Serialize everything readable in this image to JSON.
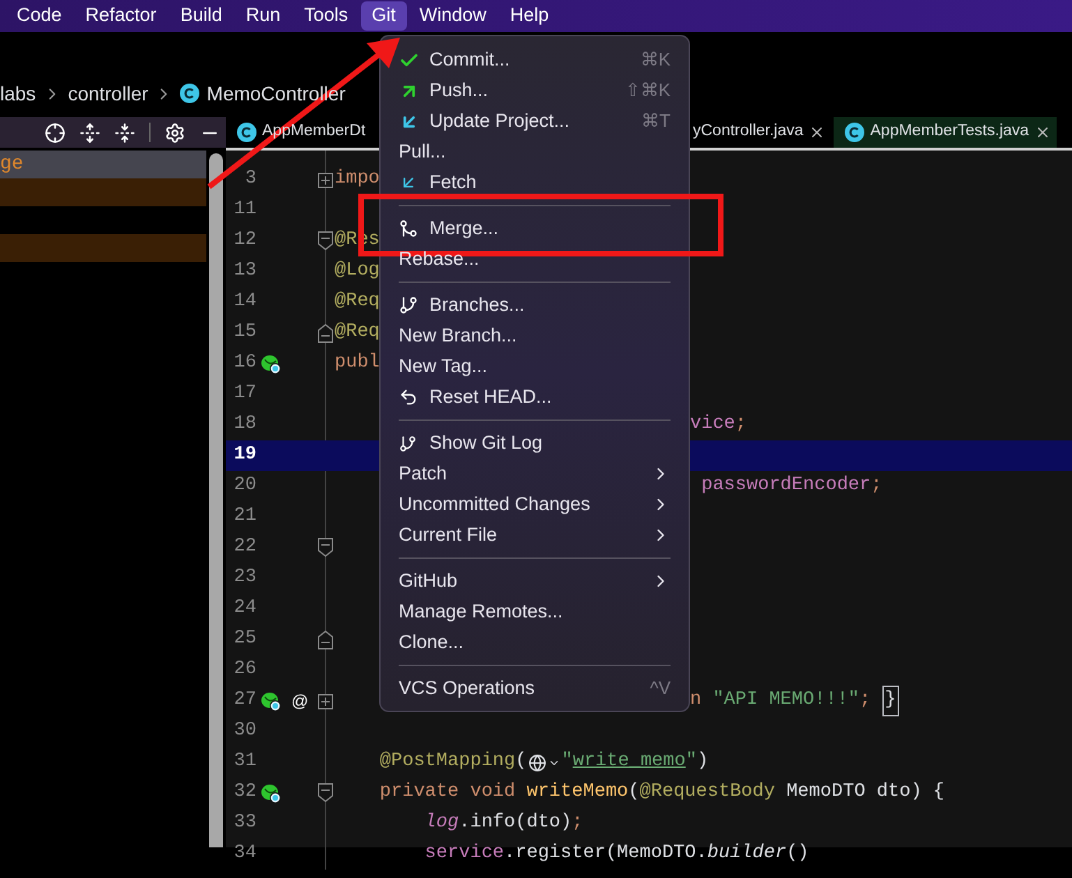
{
  "menu_bar": [
    {
      "label": "Code",
      "selected": false
    },
    {
      "label": "Refactor",
      "selected": false
    },
    {
      "label": "Build",
      "selected": false
    },
    {
      "label": "Run",
      "selected": false
    },
    {
      "label": "Tools",
      "selected": false
    },
    {
      "label": "Git",
      "selected": true
    },
    {
      "label": "Window",
      "selected": false
    },
    {
      "label": "Help",
      "selected": false
    }
  ],
  "breadcrumb": [
    {
      "label": "labs",
      "kind": "package"
    },
    {
      "label": "controller",
      "kind": "package"
    },
    {
      "label": "MemoController",
      "kind": "class"
    }
  ],
  "tool_window": {
    "rows": [
      {
        "text": "ge",
        "selected": true,
        "highlighted": false
      },
      {
        "selected": false,
        "highlighted": true
      },
      {
        "selected": false,
        "highlighted": false
      },
      {
        "selected": false,
        "highlighted": true
      }
    ]
  },
  "editor_tabs": [
    {
      "label": "AppMemberDt",
      "selected": false,
      "closable": false
    },
    {
      "label": "yController.java",
      "selected": false,
      "closable": true
    },
    {
      "label": "AppMemberTests.java",
      "selected": true,
      "closable": true
    }
  ],
  "code_lines": [
    {
      "number": "3",
      "current": false,
      "bean": false,
      "fold": {
        "kind": "expand"
      },
      "code": [
        {
          "text": "impo",
          "kind": "keyword"
        }
      ]
    },
    {
      "number": "11",
      "current": false,
      "bean": false
    },
    {
      "number": "12",
      "current": false,
      "bean": false,
      "fold": {
        "kind": "collapse"
      },
      "code": [
        {
          "text": "@Res",
          "kind": "annotation"
        }
      ]
    },
    {
      "number": "13",
      "current": false,
      "bean": false,
      "code": [
        {
          "text": "@Log",
          "kind": "annotation"
        }
      ]
    },
    {
      "number": "14",
      "current": false,
      "bean": false,
      "code": [
        {
          "text": "@Req",
          "kind": "annotation"
        }
      ]
    },
    {
      "number": "15",
      "current": false,
      "bean": false,
      "fold": {
        "kind": "end"
      },
      "code": [
        {
          "text": "@Req",
          "kind": "annotation"
        }
      ]
    },
    {
      "number": "16",
      "current": false,
      "bean": true,
      "code": [
        {
          "text": "publ",
          "kind": "keyword"
        }
      ]
    },
    {
      "number": "17",
      "current": false,
      "bean": false
    },
    {
      "number": "18",
      "current": false,
      "bean": false,
      "code_right": [
        {
          "text": "vice",
          "kind": "field"
        },
        {
          "text": ";",
          "kind": "punct"
        }
      ]
    },
    {
      "number": "19",
      "current": true,
      "bean": false
    },
    {
      "number": "20",
      "current": false,
      "bean": false,
      "code_right": [
        {
          "text": " passwordEncoder",
          "kind": "field"
        },
        {
          "text": ";",
          "kind": "punct"
        }
      ]
    },
    {
      "number": "21",
      "current": false,
      "bean": false
    },
    {
      "number": "22",
      "current": false,
      "bean": false,
      "fold": {
        "kind": "collapse"
      }
    },
    {
      "number": "23",
      "current": false,
      "bean": false
    },
    {
      "number": "24",
      "current": false,
      "bean": false
    },
    {
      "number": "25",
      "current": false,
      "bean": false,
      "fold": {
        "kind": "end"
      }
    },
    {
      "number": "26",
      "current": false,
      "bean": false
    },
    {
      "number": "27",
      "current": false,
      "bean": true,
      "marker_text": "@",
      "fold": {
        "kind": "expand"
      },
      "code_right": [
        {
          "text": "n ",
          "kind": "keyword"
        },
        {
          "text": "\"API MEMO!!!\"",
          "kind": "string"
        },
        {
          "text": ";",
          "kind": "punct"
        },
        {
          "text": "}",
          "kind": "boxed"
        }
      ]
    },
    {
      "number": "30",
      "current": false,
      "bean": false
    },
    {
      "number": "31",
      "current": false,
      "bean": false,
      "code": [
        {
          "text": "    @PostMapping",
          "kind": "annotation"
        },
        {
          "text": "(",
          "kind": "plain"
        },
        {
          "kind": "inlay"
        },
        {
          "text": "\"",
          "kind": "string"
        },
        {
          "text": "write_memo",
          "kind": "link"
        },
        {
          "text": "\"",
          "kind": "string"
        },
        {
          "text": ")",
          "kind": "plain"
        }
      ]
    },
    {
      "number": "32",
      "current": false,
      "bean": true,
      "fold": {
        "kind": "collapse"
      },
      "code": [
        {
          "text": "    private void ",
          "kind": "keyword"
        },
        {
          "text": "writeMemo",
          "kind": "method"
        },
        {
          "text": "(",
          "kind": "plain"
        },
        {
          "text": "@RequestBody",
          "kind": "annotation"
        },
        {
          "text": " MemoDTO dto) {",
          "kind": "plain"
        }
      ]
    },
    {
      "number": "33",
      "current": false,
      "bean": false,
      "code": [
        {
          "text": "        log",
          "kind": "field_italic"
        },
        {
          "text": ".info(dto)",
          "kind": "plain"
        },
        {
          "text": ";",
          "kind": "punct"
        }
      ]
    },
    {
      "number": "34",
      "current": false,
      "bean": false,
      "code": [
        {
          "text": "        service",
          "kind": "field"
        },
        {
          "text": ".register(MemoDTO.",
          "kind": "plain"
        },
        {
          "text": "builder",
          "kind": "plain_italic"
        },
        {
          "text": "()",
          "kind": "plain"
        }
      ]
    }
  ],
  "git_menu": [
    {
      "kind": "item",
      "label": "Commit...",
      "shortcut": "⌘K",
      "submenu": false
    },
    {
      "kind": "item",
      "label": "Push...",
      "shortcut": "⇧⌘K",
      "submenu": false
    },
    {
      "kind": "item",
      "label": "Update Project...",
      "shortcut": "⌘T",
      "submenu": false
    },
    {
      "kind": "item",
      "label": "Pull...",
      "submenu": false
    },
    {
      "kind": "item",
      "label": "Fetch",
      "submenu": false
    },
    {
      "kind": "separator"
    },
    {
      "kind": "item",
      "label": "Merge...",
      "submenu": false
    },
    {
      "kind": "item",
      "label": "Rebase...",
      "submenu": false
    },
    {
      "kind": "separator"
    },
    {
      "kind": "item",
      "label": "Branches...",
      "submenu": false
    },
    {
      "kind": "item",
      "label": "New Branch...",
      "submenu": false
    },
    {
      "kind": "item",
      "label": "New Tag...",
      "submenu": false
    },
    {
      "kind": "item",
      "label": "Reset HEAD...",
      "submenu": false
    },
    {
      "kind": "separator"
    },
    {
      "kind": "item",
      "label": "Show Git Log",
      "submenu": false
    },
    {
      "kind": "item",
      "label": "Patch",
      "submenu": true
    },
    {
      "kind": "item",
      "label": "Uncommitted Changes",
      "submenu": true
    },
    {
      "kind": "item",
      "label": "Current File",
      "submenu": true
    },
    {
      "kind": "separator"
    },
    {
      "kind": "item",
      "label": "GitHub",
      "submenu": true
    },
    {
      "kind": "item",
      "label": "Manage Remotes...",
      "submenu": false
    },
    {
      "kind": "item",
      "label": "Clone...",
      "submenu": false
    },
    {
      "kind": "separator"
    },
    {
      "kind": "item",
      "label": "VCS Operations",
      "shortcut": "^V",
      "submenu": false
    }
  ]
}
